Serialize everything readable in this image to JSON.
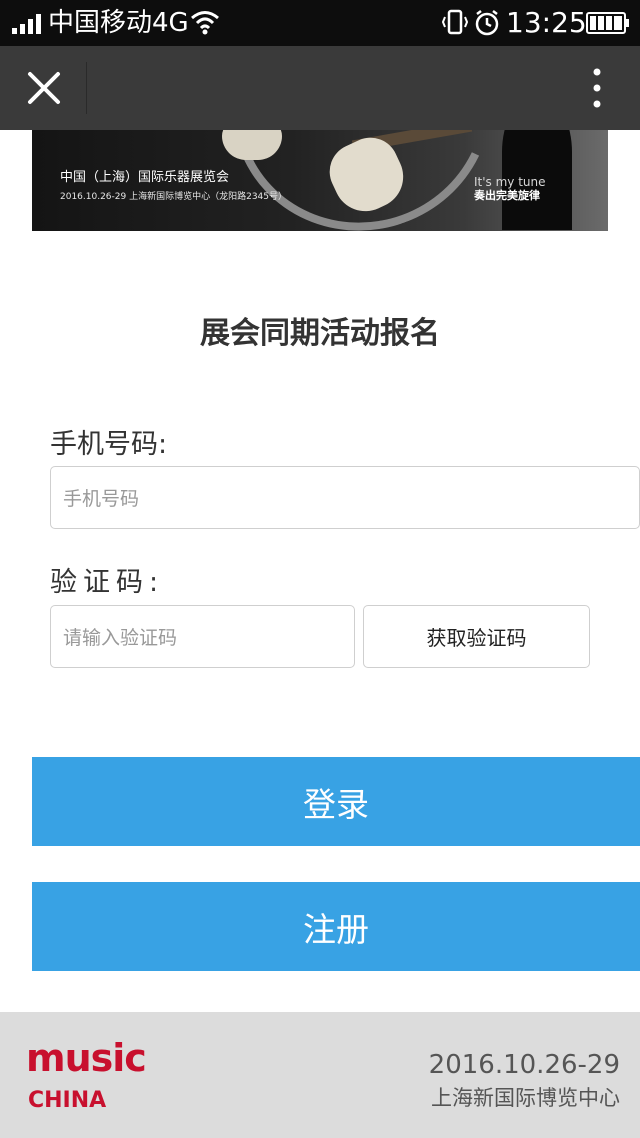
{
  "status_bar": {
    "carrier": "中国移动4G",
    "time": "13:25"
  },
  "banner": {
    "title": "中国（上海）国际乐器展览会",
    "subtitle": "2016.10.26-29  上海新国际博览中心（龙阳路2345号）",
    "tagline_en": "It's my tune",
    "tagline_cn": "奏出完美旋律"
  },
  "form": {
    "title": "展会同期活动报名",
    "phone_label": "手机号码:",
    "phone_placeholder": "手机号码",
    "code_label": "验证码:",
    "code_placeholder": "请输入验证码",
    "get_code_label": "获取验证码"
  },
  "actions": {
    "login_label": "登录",
    "register_label": "注册",
    "color": "#38a2e4"
  },
  "footer": {
    "logo_music": "music",
    "logo_china": "CHINA",
    "dates": "2016.10.26-29",
    "venue": "上海新国际博览中心",
    "brand_color": "#c8102e"
  }
}
